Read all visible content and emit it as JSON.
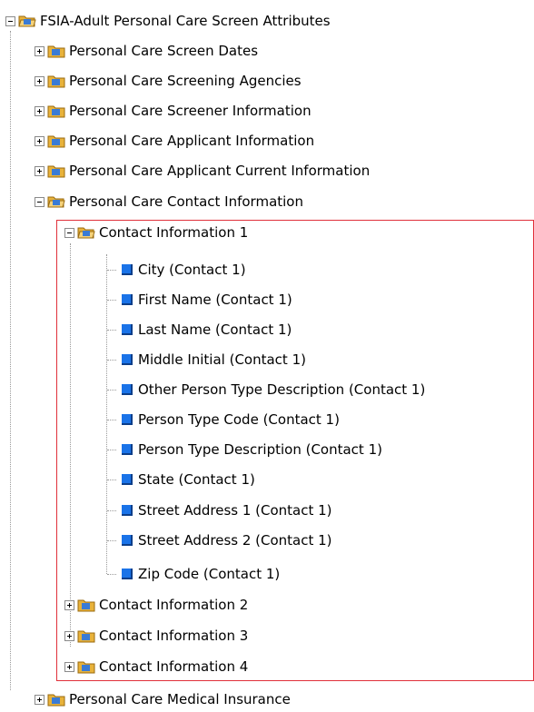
{
  "tree": {
    "root": {
      "label": "FSIA-Adult Personal Care Screen Attributes",
      "state": "expanded"
    },
    "level1": [
      {
        "label": "Personal Care Screen Dates",
        "state": "collapsed"
      },
      {
        "label": "Personal Care Screening Agencies",
        "state": "collapsed"
      },
      {
        "label": "Personal Care Screener Information",
        "state": "collapsed"
      },
      {
        "label": "Personal Care Applicant Information",
        "state": "collapsed"
      },
      {
        "label": "Personal Care Applicant Current Information",
        "state": "collapsed"
      },
      {
        "label": "Personal Care Contact Information",
        "state": "expanded"
      }
    ],
    "contact_groups": [
      {
        "label": "Contact Information 1",
        "state": "expanded"
      },
      {
        "label": "Contact Information 2",
        "state": "collapsed"
      },
      {
        "label": "Contact Information 3",
        "state": "collapsed"
      },
      {
        "label": "Contact Information 4",
        "state": "collapsed"
      }
    ],
    "contact1_fields": [
      "City (Contact 1)",
      "First Name (Contact 1)",
      "Last Name (Contact 1)",
      "Middle Initial (Contact 1)",
      "Other Person Type Description (Contact 1)",
      "Person Type Code (Contact 1)",
      "Person Type Description (Contact 1)",
      "State (Contact 1)",
      "Street Address 1 (Contact 1)",
      "Street Address 2 (Contact 1)",
      "Zip Code (Contact 1)"
    ],
    "after": [
      {
        "label": "Personal Care Medical Insurance",
        "state": "collapsed"
      }
    ]
  },
  "colors": {
    "highlight": "#e0303a",
    "leaf_icon": "#1a73e8",
    "folder": "#e8b23a"
  }
}
